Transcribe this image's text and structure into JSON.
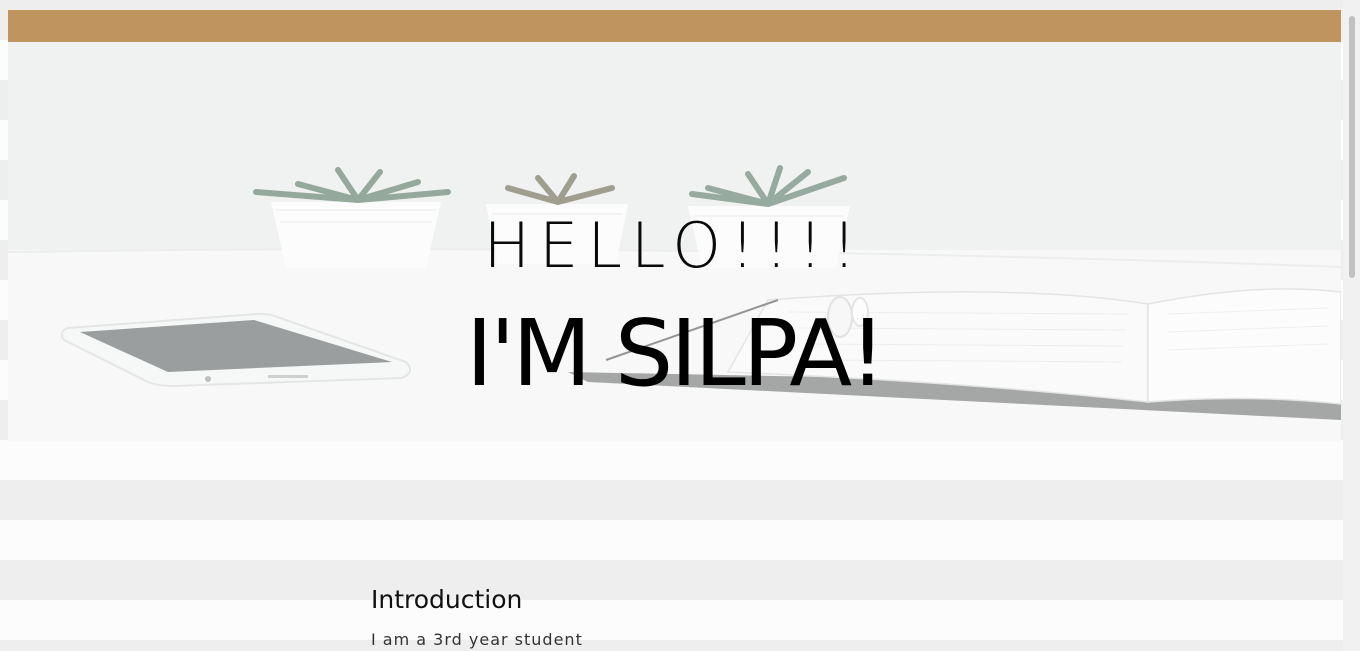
{
  "header": {
    "accent_color": "#c0945e"
  },
  "hero": {
    "greeting": "HELLO!!!!",
    "name": "I'M SILPA!",
    "background_image": "desk-with-succulents-phone-notebook"
  },
  "intro": {
    "heading": "Introduction",
    "text": "I am a 3rd year student"
  },
  "scrollbar": {
    "position_fraction": 0
  }
}
